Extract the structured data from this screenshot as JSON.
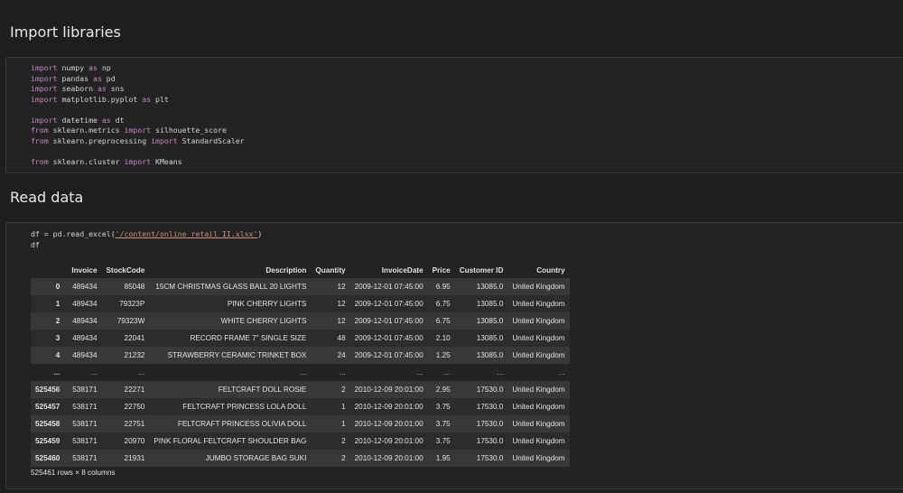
{
  "headings": {
    "import": "Import libraries",
    "read": "Read data"
  },
  "code_cell_1": {
    "lines": [
      [
        {
          "t": "import",
          "k": "kw"
        },
        {
          "t": " numpy "
        },
        {
          "t": "as",
          "k": "kw"
        },
        {
          "t": " np"
        }
      ],
      [
        {
          "t": "import",
          "k": "kw"
        },
        {
          "t": " pandas "
        },
        {
          "t": "as",
          "k": "kw"
        },
        {
          "t": " pd"
        }
      ],
      [
        {
          "t": "import",
          "k": "kw"
        },
        {
          "t": " seaborn "
        },
        {
          "t": "as",
          "k": "kw"
        },
        {
          "t": " sns"
        }
      ],
      [
        {
          "t": "import",
          "k": "kw"
        },
        {
          "t": " matplotlib.pyplot "
        },
        {
          "t": "as",
          "k": "kw"
        },
        {
          "t": " plt"
        }
      ],
      [],
      [
        {
          "t": "import",
          "k": "kw"
        },
        {
          "t": " datetime "
        },
        {
          "t": "as",
          "k": "kw"
        },
        {
          "t": " dt"
        }
      ],
      [
        {
          "t": "from",
          "k": "kw"
        },
        {
          "t": " sklearn.metrics "
        },
        {
          "t": "import",
          "k": "kw"
        },
        {
          "t": " silhouette_score"
        }
      ],
      [
        {
          "t": "from",
          "k": "kw"
        },
        {
          "t": " sklearn.preprocessing "
        },
        {
          "t": "import",
          "k": "kw"
        },
        {
          "t": " StandardScaler"
        }
      ],
      [],
      [
        {
          "t": "from",
          "k": "kw"
        },
        {
          "t": " sklearn.cluster "
        },
        {
          "t": "import",
          "k": "kw"
        },
        {
          "t": " KMeans"
        }
      ]
    ]
  },
  "code_cell_2": {
    "lines": [
      [
        {
          "t": "df = pd.read_excel("
        },
        {
          "t": "'/content/online_retail_II.xlsx'",
          "k": "str"
        },
        {
          "t": ")"
        }
      ],
      [
        {
          "t": "df"
        }
      ]
    ]
  },
  "dataframe": {
    "columns": [
      "",
      "Invoice",
      "StockCode",
      "Description",
      "Quantity",
      "InvoiceDate",
      "Price",
      "Customer ID",
      "Country"
    ],
    "rows": [
      [
        "0",
        "489434",
        "85048",
        "15CM CHRISTMAS GLASS BALL 20 LIGHTS",
        "12",
        "2009-12-01 07:45:00",
        "6.95",
        "13085.0",
        "United Kingdom"
      ],
      [
        "1",
        "489434",
        "79323P",
        "PINK CHERRY LIGHTS",
        "12",
        "2009-12-01 07:45:00",
        "6.75",
        "13085.0",
        "United Kingdom"
      ],
      [
        "2",
        "489434",
        "79323W",
        "WHITE CHERRY LIGHTS",
        "12",
        "2009-12-01 07:45:00",
        "6.75",
        "13085.0",
        "United Kingdom"
      ],
      [
        "3",
        "489434",
        "22041",
        "RECORD FRAME 7\" SINGLE SIZE",
        "48",
        "2009-12-01 07:45:00",
        "2.10",
        "13085.0",
        "United Kingdom"
      ],
      [
        "4",
        "489434",
        "21232",
        "STRAWBERRY CERAMIC TRINKET BOX",
        "24",
        "2009-12-01 07:45:00",
        "1.25",
        "13085.0",
        "United Kingdom"
      ],
      [
        "...",
        "...",
        "...",
        "...",
        "...",
        "...",
        "...",
        "...",
        "..."
      ],
      [
        "525456",
        "538171",
        "22271",
        "FELTCRAFT DOLL ROSIE",
        "2",
        "2010-12-09 20:01:00",
        "2.95",
        "17530.0",
        "United Kingdom"
      ],
      [
        "525457",
        "538171",
        "22750",
        "FELTCRAFT PRINCESS LOLA DOLL",
        "1",
        "2010-12-09 20:01:00",
        "3.75",
        "17530.0",
        "United Kingdom"
      ],
      [
        "525458",
        "538171",
        "22751",
        "FELTCRAFT PRINCESS OLIVIA DOLL",
        "1",
        "2010-12-09 20:01:00",
        "3.75",
        "17530.0",
        "United Kingdom"
      ],
      [
        "525459",
        "538171",
        "20970",
        "PINK FLORAL FELTCRAFT SHOULDER BAG",
        "2",
        "2010-12-09 20:01:00",
        "3.75",
        "17530.0",
        "United Kingdom"
      ],
      [
        "525460",
        "538171",
        "21931",
        "JUMBO STORAGE BAG SUKI",
        "2",
        "2010-12-09 20:01:00",
        "1.95",
        "17530.0",
        "United Kingdom"
      ]
    ],
    "shape_text": "525461 rows × 8 columns"
  },
  "colors": {
    "background": "#1e1e1e",
    "keyword": "#c586c0",
    "string": "#ce9178",
    "row_stripe": "#383838"
  }
}
